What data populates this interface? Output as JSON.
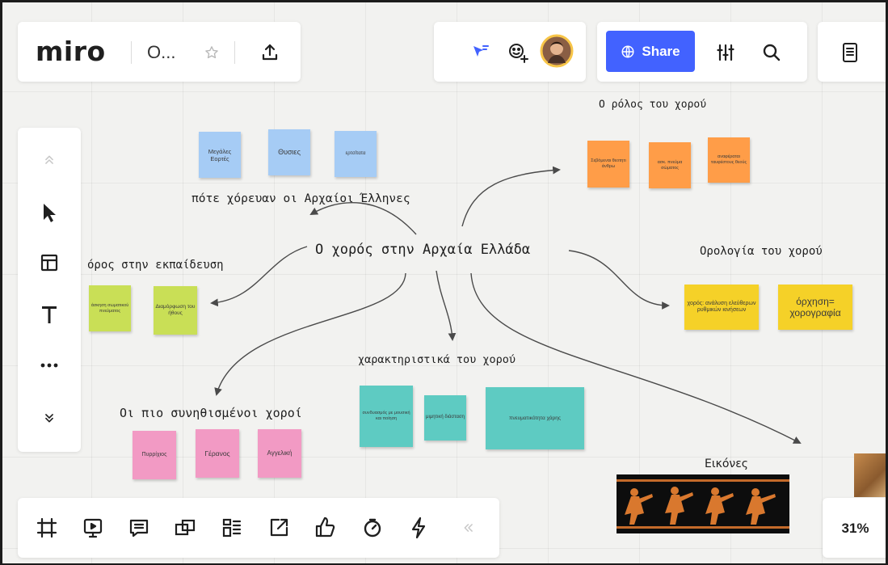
{
  "app": {
    "logo": "miro",
    "board_name": "O...",
    "share_label": "Share",
    "zoom": "31%"
  },
  "top_left_toolbar": [
    "star-icon",
    "upload-icon"
  ],
  "collab_toolbar": [
    "reactions-icon",
    "add-collaborator-icon",
    "user-avatar"
  ],
  "share_toolbar": [
    "globe-icon",
    "share-button",
    "settings-sliders-icon",
    "search-icon"
  ],
  "left_toolbar": [
    "collapse-up-icon",
    "select-cursor-icon",
    "templates-icon",
    "text-tool-icon",
    "more-tools-icon",
    "expand-down-icon"
  ],
  "bottom_toolbar": [
    "frames-icon",
    "presentation-icon",
    "comments-icon",
    "cards-icon",
    "kanban-icon",
    "share-screen-icon",
    "voting-icon",
    "timer-icon",
    "power-icon",
    "collapse-left-icon"
  ],
  "colors": {
    "accent": "#4262ff",
    "canvas": "#f2f2f0"
  },
  "canvas": {
    "center_title": "Ο χορός στην Αρχαία Ελλάδα",
    "groups": {
      "when": {
        "label": "πότε χόρευαν οι Αρχαίοι Έλληνες",
        "notes": [
          "Μεγάλες Εορτές",
          "Θυσιες",
          "ερτσίτατα"
        ]
      },
      "role": {
        "label": "Ο ρόλος του χορού",
        "notes": [
          "Σεβόμεναι θεοτητι άνθρω",
          "ασκ. πνεύμα σώματος",
          "αναφέραται ταυφέστους θεούς"
        ]
      },
      "education": {
        "label": "όρος στην εκπαίδευση",
        "notes": [
          "άσκηση σωματικού πνεύματος",
          "Διαμόρφωση του ήθους"
        ]
      },
      "terminology": {
        "label": "Ορολογία του χορού",
        "notes": [
          "χορός: ανάλυση ελεύθερων ρυθμικών κινήσεων",
          "όρχηση= χορογραφία"
        ]
      },
      "characteristics": {
        "label": "χαρακτηριστικά του χορού",
        "notes": [
          "συνδυασμός με μουσική και ποίηση",
          "μιμητική διάσταση",
          "πνευματικότητα χάρης"
        ]
      },
      "common": {
        "label": "Οι πιο συνηθισμένοι χοροί",
        "notes": [
          "Πυρρίχιος",
          "Γέρανος",
          "Αγγελική"
        ]
      },
      "images": {
        "label": "Εικόνες"
      }
    }
  }
}
